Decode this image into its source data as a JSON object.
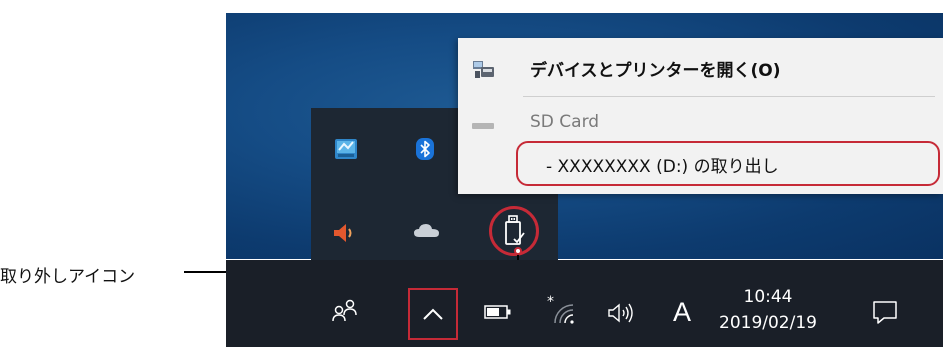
{
  "context_menu": {
    "open_devices": "デバイスとプリンターを開く(O)",
    "device_name": "SD Card",
    "eject_item": "-  XXXXXXXX (D:) の取り出し"
  },
  "callout": {
    "label": "取り外しアイコン"
  },
  "taskbar": {
    "time": "10:44",
    "date": "2019/02/19",
    "ime_indicator": "A"
  },
  "colors": {
    "highlight_red": "#c62a37",
    "taskbar": "#1a1f28",
    "flyout": "#1d2733",
    "desktop": "#0e3f74"
  },
  "icons": [
    "people-icon",
    "show-hidden-icons-chevron",
    "battery-icon",
    "wifi-icon",
    "volume-icon",
    "action-center-icon",
    "intel-graphics-icon",
    "bluetooth-icon",
    "speaker-icon",
    "onedrive-icon",
    "safely-remove-hardware-icon",
    "devices-printers-icon"
  ]
}
